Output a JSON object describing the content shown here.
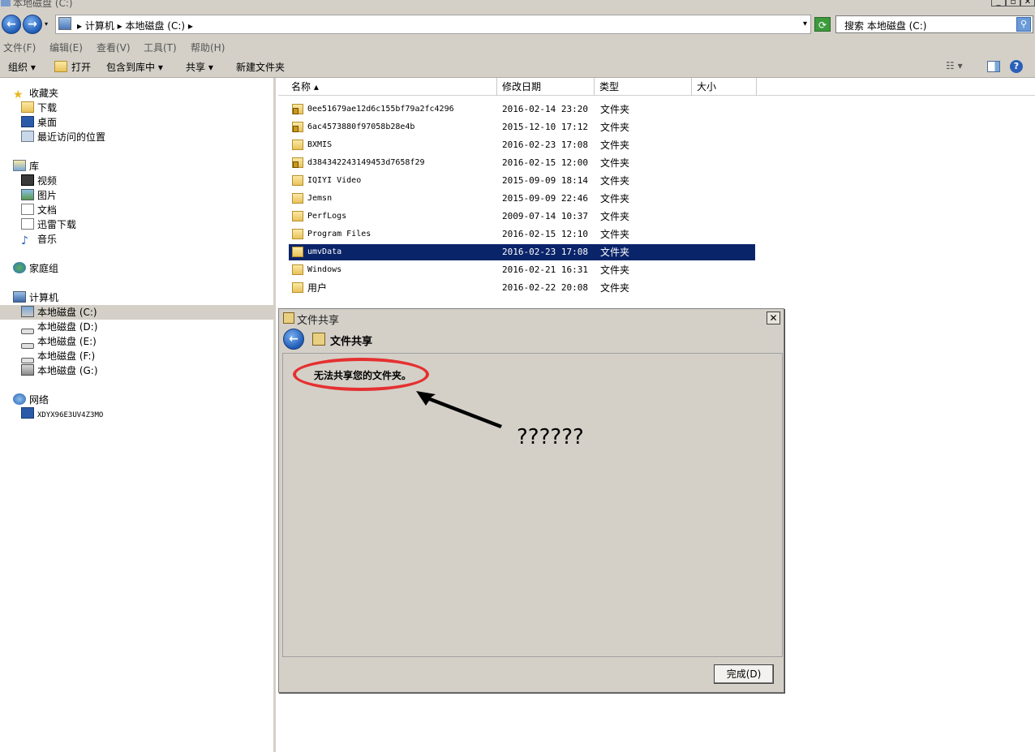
{
  "window": {
    "title": "本地磁盘 (C:)"
  },
  "address": {
    "path": "▸ 计算机 ▸ 本地磁盘 (C:) ▸",
    "search_placeholder": "搜索 本地磁盘 (C:)"
  },
  "menu": [
    "文件(F)",
    "编辑(E)",
    "查看(V)",
    "工具(T)",
    "帮助(H)"
  ],
  "toolbar": {
    "organize": "组织 ▾",
    "open": "打开",
    "include_library": "包含到库中 ▾",
    "share": "共享 ▾",
    "new_folder": "新建文件夹"
  },
  "nav": {
    "favorites": "收藏夹",
    "downloads": "下载",
    "desktop": "桌面",
    "recent": "最近访问的位置",
    "libraries": "库",
    "videos": "视频",
    "pictures": "图片",
    "documents": "文档",
    "thunder": "迅雷下载",
    "music": "音乐",
    "homegroup": "家庭组",
    "computer": "计算机",
    "drive_c": "本地磁盘 (C:)",
    "drive_d": "本地磁盘 (D:)",
    "drive_e": "本地磁盘 (E:)",
    "drive_f": "本地磁盘 (F:)",
    "drive_g": "本地磁盘 (G:)",
    "network": "网络",
    "network_pc": "XDYX96E3UV4Z3MO"
  },
  "columns": {
    "name": "名称 ▴",
    "modified": "修改日期",
    "type": "类型",
    "size": "大小"
  },
  "files": [
    {
      "name": "0ee51679ae12d6c155bf79a2fc4296",
      "date": "2016-02-14 23:20",
      "type": "文件夹"
    },
    {
      "name": "6ac4573880f97058b28e4b",
      "date": "2015-12-10 17:12",
      "type": "文件夹"
    },
    {
      "name": "BXMIS",
      "date": "2016-02-23 17:08",
      "type": "文件夹"
    },
    {
      "name": "d384342243149453d7658f29",
      "date": "2016-02-15 12:00",
      "type": "文件夹"
    },
    {
      "name": "IQIYI Video",
      "date": "2015-09-09 18:14",
      "type": "文件夹"
    },
    {
      "name": "Jemsn",
      "date": "2015-09-09 22:46",
      "type": "文件夹"
    },
    {
      "name": "PerfLogs",
      "date": "2009-07-14 10:37",
      "type": "文件夹"
    },
    {
      "name": "Program Files",
      "date": "2016-02-15 12:10",
      "type": "文件夹"
    },
    {
      "name": "umvData",
      "date": "2016-02-23 17:08",
      "type": "文件夹"
    },
    {
      "name": "Windows",
      "date": "2016-02-21 16:31",
      "type": "文件夹"
    },
    {
      "name": "用户",
      "date": "2016-02-22 20:08",
      "type": "文件夹"
    }
  ],
  "dialog": {
    "title": "文件共享",
    "header": "文件共享",
    "message": "无法共享您的文件夹。",
    "annotation": "??????",
    "done": "完成(D)"
  }
}
